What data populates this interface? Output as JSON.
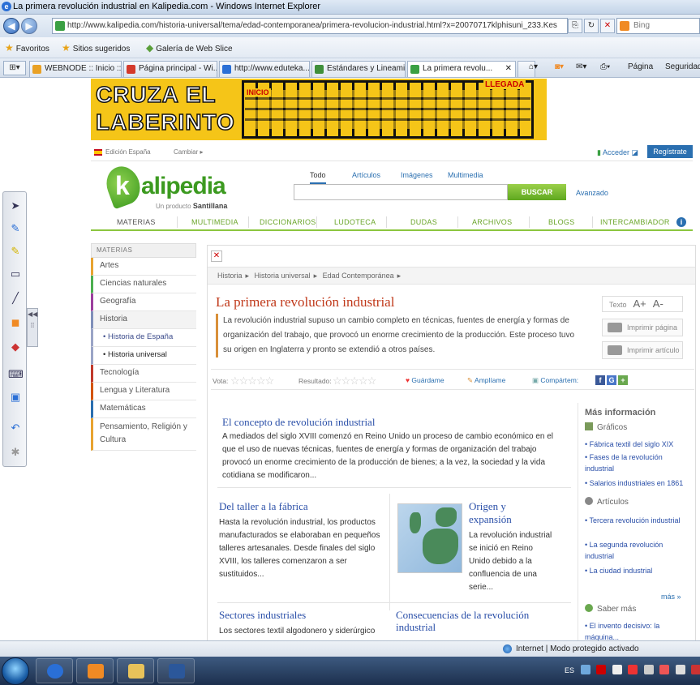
{
  "window": {
    "title": "La primera revolución industrial en Kalipedia.com - Windows Internet Explorer"
  },
  "navbar": {
    "url": "http://www.kalipedia.com/historia-universal/tema/edad-contemporanea/primera-revolucion-industrial.html?x=20070717klphisuni_233.Kes",
    "search_engine": "Bing"
  },
  "favbar": {
    "favorites": "Favoritos",
    "suggested": "Sitios sugeridos",
    "webslice": "Galería de Web Slice"
  },
  "tabs": [
    {
      "label": "WEBNODE :: Inicio ::",
      "color": "#e9a125"
    },
    {
      "label": "Página principal - Wi...",
      "color": "#d43a2b"
    },
    {
      "label": "http://www.eduteka...",
      "color": "#2a6fd6"
    },
    {
      "label": "Estándares y Lineami...",
      "color": "#3f8f3a"
    },
    {
      "label": "La primera revolu...",
      "color": "#3aa043"
    }
  ],
  "commands": {
    "page": "Página",
    "safety": "Seguridad"
  },
  "banner": {
    "line1": "CRUZA EL",
    "line2": "LABERINTO",
    "start": "INICIO",
    "end": "LLEGADA"
  },
  "header": {
    "edition": "Edición España",
    "change": "Cambiar",
    "login": "Acceder",
    "register": "Regístrate",
    "logo_text": "alipedia",
    "logo_letter": "k",
    "logo_sub": "Un producto",
    "logo_brand": "Santillana",
    "search_tabs": [
      "Todo",
      "Artículos",
      "Imágenes",
      "Multimedia"
    ],
    "search_button": "BUSCAR",
    "advanced": "Avanzado",
    "nav": [
      "MATERIAS",
      "MULTIMEDIA",
      "DICCIONARIOS",
      "LUDOTECA",
      "DUDAS",
      "ARCHIVOS",
      "BLOGS",
      "INTERCAMBIADOR"
    ]
  },
  "leftmenu": {
    "title": "MATERIAS",
    "items": [
      {
        "label": "Artes",
        "color": "#e8a330"
      },
      {
        "label": "Ciencias naturales",
        "color": "#4caf50"
      },
      {
        "label": "Geografía",
        "color": "#9c3f9e"
      },
      {
        "label": "Historia",
        "color": "#7f8fb9"
      },
      {
        "label": "Historia de España",
        "color": "#9aa4c6"
      },
      {
        "label": "Historia universal",
        "color": "#9aa4c6"
      },
      {
        "label": "Tecnología",
        "color": "#c0392b"
      },
      {
        "label": "Lengua y Literatura",
        "color": "#d35400"
      },
      {
        "label": "Matemáticas",
        "color": "#2a6fb0"
      },
      {
        "label": "Pensamiento, Religión y Cultura",
        "color": "#e8a330"
      }
    ]
  },
  "article": {
    "breadcrumb": [
      "Historia",
      "Historia universal",
      "Edad Contemporánea"
    ],
    "title": "La primera revolución industrial",
    "lead": "La revolución industrial supuso un cambio completo en técnicas, fuentes de energía y formas de organización del trabajo, que provocó un enorme crecimiento de la producción. Este proceso tuvo su origen en Inglaterra y pronto se extendió a otros países.",
    "text_label": "Texto",
    "font_up": "A+",
    "font_down": "A-",
    "print_page": "Imprimir página",
    "print_article": "Imprimir artículo",
    "vote_label": "Vota:",
    "result_label": "Resultado:",
    "save": "Guárdame",
    "expand": "Amplíame",
    "share": "Compártem:",
    "sections": [
      {
        "title": "El concepto de revolución industrial",
        "text": "A mediados del siglo XVIII comenzó en Reino Unido un proceso de cambio económico en el que el uso de nuevas técnicas, fuentes de energía y formas de organización del trabajo provocó un enorme crecimiento de la producción de bienes; a la vez, la sociedad y la vida cotidiana se modificaron..."
      },
      {
        "title": "Del taller a la fábrica",
        "text": "Hasta la revolución industrial, los productos manufacturados se elaboraban en pequeños talleres artesanales. Desde finales del siglo XVIII, los talleres comenzaron a ser sustituidos..."
      },
      {
        "title": "Origen y expansión",
        "text": "La revolución industrial se inició en Reino Unido debido a la confluencia de una serie..."
      },
      {
        "title": "Sectores industriales",
        "text": "Los sectores textil algodonero y siderúrgico"
      },
      {
        "title": "Consecuencias de la revolución industrial",
        "text": ""
      }
    ]
  },
  "sidebar": {
    "title": "Más información",
    "graphics_label": "Gráficos",
    "graphics": [
      "Fábrica textil del siglo XIX",
      "Fases de la revolución industrial",
      "Salarios industriales en 1861"
    ],
    "articles_label": "Artículos",
    "articles": [
      "Tercera revolución industrial",
      "La segunda revolución industrial",
      "La ciudad industrial"
    ],
    "more": "más",
    "know_more": "Saber más",
    "know_more_items": [
      "El invento decisivo: la máquina..."
    ]
  },
  "status": {
    "text": "Internet | Modo protegido activado"
  },
  "tray": {
    "lang": "ES"
  }
}
